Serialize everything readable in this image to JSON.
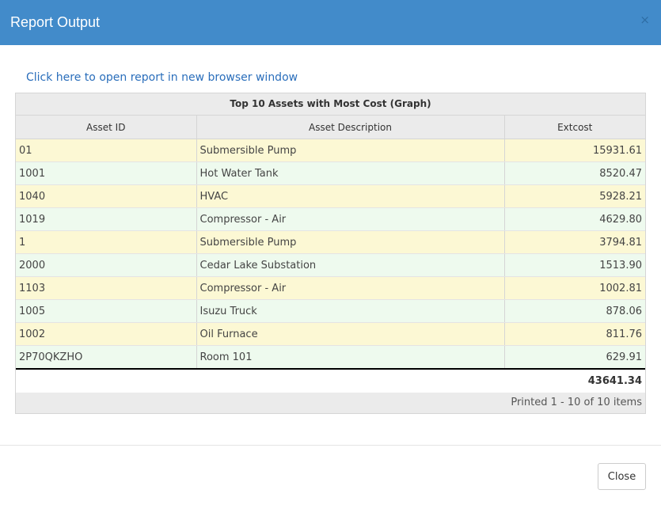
{
  "dialog": {
    "title": "Report Output",
    "close_glyph": "×",
    "open_link": "Click here to open report in new browser window",
    "close_button": "Close"
  },
  "report": {
    "title": "Top 10 Assets with Most Cost (Graph)",
    "columns": [
      "Asset ID",
      "Asset Description",
      "Extcost"
    ],
    "rows": [
      {
        "id": "01",
        "desc": "Submersible Pump",
        "cost": "15931.61"
      },
      {
        "id": "1001",
        "desc": "Hot Water Tank",
        "cost": "8520.47"
      },
      {
        "id": "1040",
        "desc": "HVAC",
        "cost": "5928.21"
      },
      {
        "id": "1019",
        "desc": "Compressor - Air",
        "cost": "4629.80"
      },
      {
        "id": "1",
        "desc": "Submersible Pump",
        "cost": "3794.81"
      },
      {
        "id": "2000",
        "desc": "Cedar Lake Substation",
        "cost": "1513.90"
      },
      {
        "id": "1103",
        "desc": "Compressor - Air",
        "cost": "1002.81"
      },
      {
        "id": "1005",
        "desc": "Isuzu Truck",
        "cost": "878.06"
      },
      {
        "id": "1002",
        "desc": "Oil Furnace",
        "cost": "811.76"
      },
      {
        "id": "2P70QKZHO",
        "desc": "Room 101",
        "cost": "629.91"
      }
    ],
    "total": "43641.34",
    "footer": "Printed 1 - 10 of 10 items"
  },
  "colors": {
    "header": "#428bca",
    "row_odd": "#fcf8d4",
    "row_even": "#eefaee"
  }
}
